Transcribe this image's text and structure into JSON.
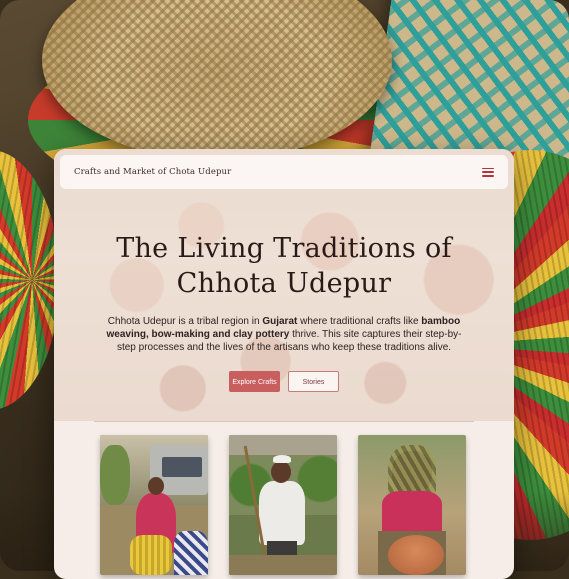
{
  "site": {
    "brand": "Crafts and Market of Chota Udepur",
    "menu_icon": "hamburger-menu-icon"
  },
  "hero": {
    "title_line1": "The Living Traditions of",
    "title_line2": "Chhota Udepur",
    "desc_part1": "Chhota Udepur is a tribal region in ",
    "desc_bold1": "Gujarat",
    "desc_part2": " where traditional crafts like ",
    "desc_bold2": "bamboo weaving, bow-making and clay pottery",
    "desc_part3": " thrive. This site captures their step-by-step processes and the lives of the artisans who keep these traditions alive.",
    "primary_button": "Explore Crafts",
    "secondary_button": "Stories"
  },
  "colors": {
    "accent": "#c95e5f",
    "menu_icon": "#b4343a",
    "card_bg": "#f6ede8"
  }
}
